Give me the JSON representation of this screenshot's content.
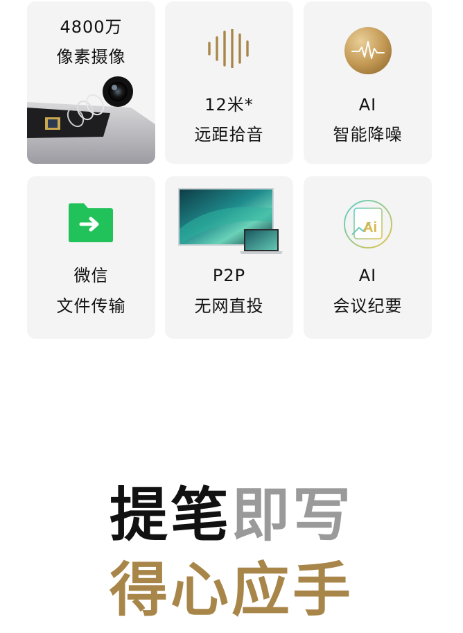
{
  "features": [
    {
      "line1": "4800万",
      "line2": "像素摄像",
      "icon": "camera-icon"
    },
    {
      "line1": "12米*",
      "line2": "远距拾音",
      "icon": "sound-wave-icon"
    },
    {
      "line1": "AI",
      "line2": "智能降噪",
      "icon": "ai-noise-reduction-icon"
    },
    {
      "line1": "微信",
      "line2": "文件传输",
      "icon": "wechat-folder-icon"
    },
    {
      "line1": "P2P",
      "line2": "无网直投",
      "icon": "screen-laptop-icon"
    },
    {
      "line1": "AI",
      "line2": "会议纪要",
      "icon": "ai-document-icon"
    }
  ],
  "headline": {
    "line1_dark": "提笔",
    "line1_grey": "即写",
    "line2": "得心应手"
  },
  "colors": {
    "gold": "#a8864a",
    "wechat_green": "#21c25a",
    "card_bg": "#f4f4f4"
  }
}
